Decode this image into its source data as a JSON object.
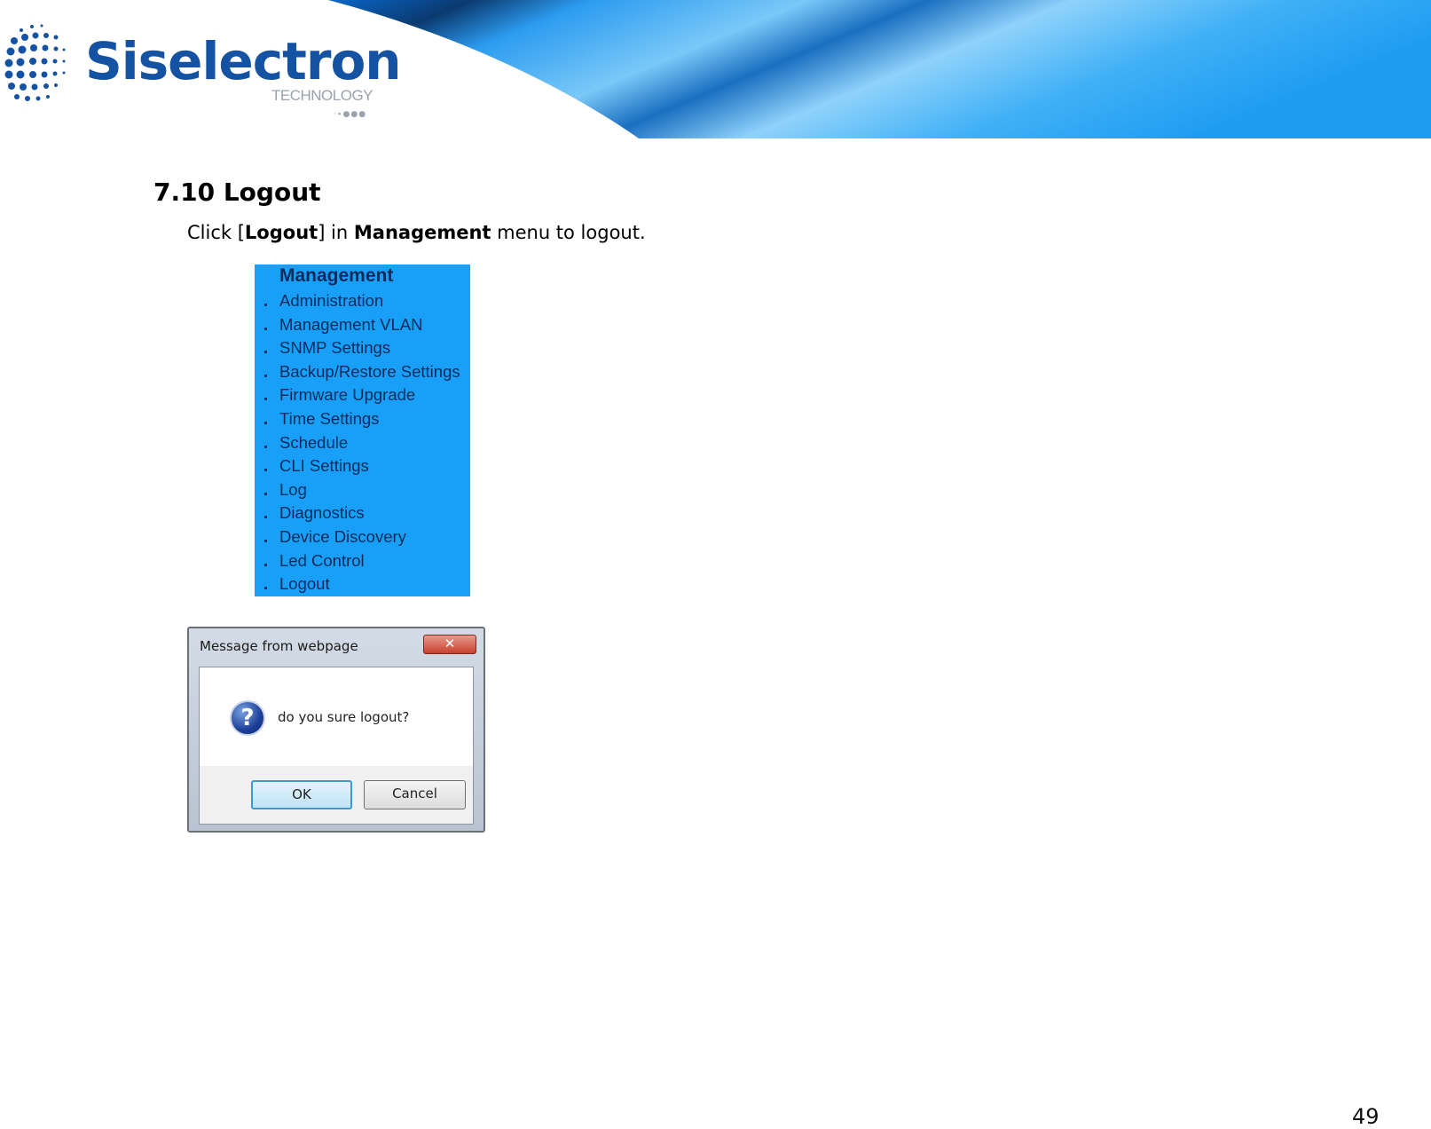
{
  "header": {
    "brand_name": "Siselectron",
    "brand_sub": "TECHNOLOGY",
    "brand_dots": "·∙●●●",
    "brand_color": "#1452a3",
    "banner_color": "#1a9cf0"
  },
  "section": {
    "title": "7.10 Logout",
    "instruction": {
      "prefix": "Click [",
      "link": "Logout",
      "middle": "] in ",
      "menu": "Management",
      "suffix": " menu to logout."
    }
  },
  "menu": {
    "title": "Management",
    "background": "#18a0f8",
    "items": [
      {
        "label": "Administration"
      },
      {
        "label": "Management VLAN"
      },
      {
        "label": "SNMP Settings"
      },
      {
        "label": "Backup/Restore Settings"
      },
      {
        "label": "Firmware Upgrade"
      },
      {
        "label": "Time Settings"
      },
      {
        "label": "Schedule"
      },
      {
        "label": "CLI Settings"
      },
      {
        "label": "Log"
      },
      {
        "label": "Diagnostics"
      },
      {
        "label": "Device Discovery"
      },
      {
        "label": "Led Control"
      },
      {
        "label": "Logout"
      }
    ]
  },
  "dialog": {
    "title": "Message from webpage",
    "close_label": "✕",
    "icon": "question-icon",
    "icon_glyph": "?",
    "message": "do you sure logout?",
    "ok_label": "OK",
    "cancel_label": "Cancel"
  },
  "footer": {
    "page_number": "49"
  }
}
